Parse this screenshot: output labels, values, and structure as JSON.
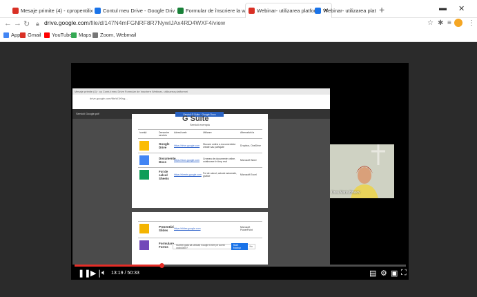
{
  "browser": {
    "tabs": [
      {
        "label": "Mesaje primite (4) - cpropentilix",
        "color": "#d93025"
      },
      {
        "label": "Contul meu Drive - Google Drive",
        "color": "#1a73e8"
      },
      {
        "label": "Formular de înscriere la webinar",
        "color": "#188038"
      },
      {
        "label": "Webinar- utilizarea platform",
        "color": "#d93025"
      },
      {
        "label": "Webinar- utilizarea platformei G",
        "color": "#1a73e8"
      }
    ],
    "new_tab_label": "+",
    "url_domain": "drive.google.com",
    "url_path": "/file/d/147N4mFGNRF8R7NywIJAx4RD4WXF4/view",
    "bookmarks": [
      {
        "label": "Apps",
        "color": "#4285f4"
      },
      {
        "label": "Gmail",
        "color": "#d93025"
      },
      {
        "label": "YouTube",
        "color": "#ff0000"
      },
      {
        "label": "Maps",
        "color": "#34a853"
      },
      {
        "label": "Zoom, Webmail",
        "color": "#777777"
      }
    ]
  },
  "inner": {
    "tabs_text": "Mesaje primite (4) · cp  Contul meu Drive  Formular de înscriere  Webinar- utilizarea platformei",
    "url": "drive.google.com/file/d/1Kfsg...",
    "file_name": "Servicii Google.pdf",
    "doc_title_bar": "Servicii G Suite - Google Docs",
    "gsuite_title": "G Suite",
    "gsuite_subtitle": "Servicii exemplu",
    "table_headers": [
      "Iconiță",
      "Denumire serviciu",
      "Adresă web",
      "Utilizare",
      "Alternativă la"
    ],
    "rows": [
      {
        "name": "Google Drive",
        "link": "https://drive.google.com",
        "use": "Stocare online a documentelor create sau partajate",
        "alt": "Dropbox, OneDrive",
        "color": "#fbbc04"
      },
      {
        "name": "Documente Docs",
        "link": "https://docs.google.com",
        "use": "Crearea de documente online, colaborare în timp real",
        "alt": "Microsoft Word",
        "color": "#4285f4"
      },
      {
        "name": "Foi de calcul Sheets",
        "link": "https://sheets.google.com",
        "use": "Foi de calcul, calcule automate, grafice",
        "alt": "Microsoft Excel",
        "color": "#0f9d58"
      }
    ],
    "rows2": [
      {
        "name": "Prezentări Slides",
        "link": "https://slides.google.com",
        "alt": "Microsoft PowerPoint",
        "color": "#f4b400"
      },
      {
        "name": "Formulare Forms",
        "link": "https://forms.google.com",
        "alt": "-",
        "color": "#7248b9"
      }
    ],
    "caption_text": "Sunteți gata să utilizați Google Drive pe acest calculator?",
    "caption_button": "Start backup",
    "caption_dismiss": "Nu"
  },
  "webcam": {
    "participant_name": "Drea Maria Brasov"
  },
  "player": {
    "current_time": "13:19",
    "duration": "50:33",
    "time_display": "13:19 / 50:33",
    "progress_fraction": 0.263
  }
}
